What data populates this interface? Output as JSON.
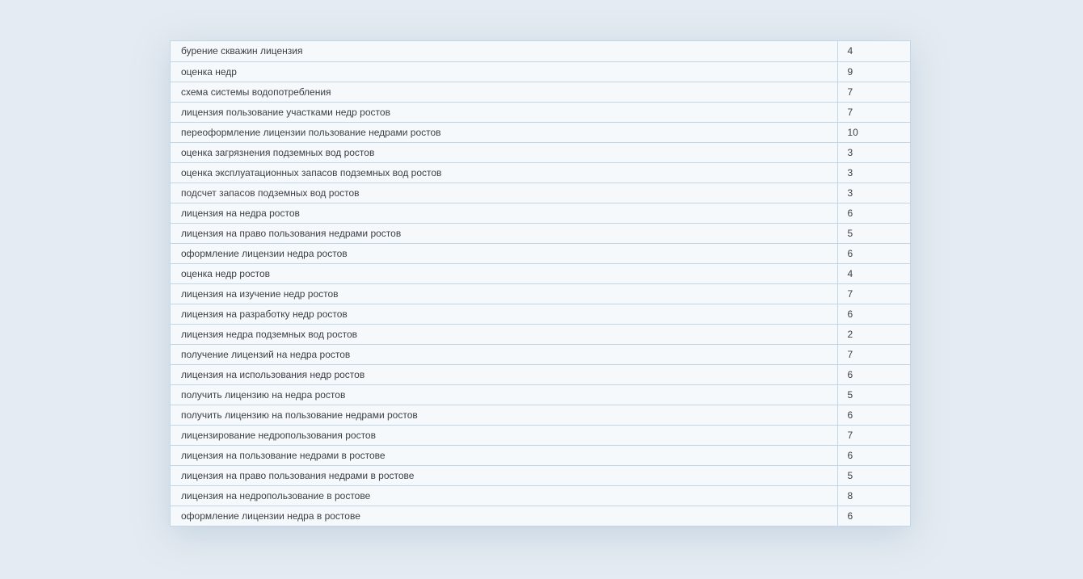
{
  "table": {
    "rows": [
      {
        "keyword": "бурение скважин лицензия",
        "count": "4"
      },
      {
        "keyword": "оценка недр",
        "count": "9"
      },
      {
        "keyword": "схема системы водопотребления",
        "count": "7"
      },
      {
        "keyword": "лицензия пользование участками недр ростов",
        "count": "7"
      },
      {
        "keyword": "переоформление лицензии пользование недрами ростов",
        "count": "10"
      },
      {
        "keyword": "оценка загрязнения подземных вод ростов",
        "count": "3"
      },
      {
        "keyword": "оценка эксплуатационных запасов подземных вод ростов",
        "count": "3"
      },
      {
        "keyword": "подсчет запасов подземных вод ростов",
        "count": "3"
      },
      {
        "keyword": "лицензия на недра ростов",
        "count": "6"
      },
      {
        "keyword": "лицензия на право пользования недрами ростов",
        "count": "5"
      },
      {
        "keyword": "оформление лицензии недра ростов",
        "count": "6"
      },
      {
        "keyword": "оценка недр ростов",
        "count": "4"
      },
      {
        "keyword": "лицензия на изучение недр ростов",
        "count": "7"
      },
      {
        "keyword": "лицензия на разработку недр ростов",
        "count": "6"
      },
      {
        "keyword": "лицензия недра подземных вод ростов",
        "count": "2"
      },
      {
        "keyword": "получение лицензий на недра ростов",
        "count": "7"
      },
      {
        "keyword": "лицензия на использования недр ростов",
        "count": "6"
      },
      {
        "keyword": "получить лицензию на недра ростов",
        "count": "5"
      },
      {
        "keyword": "получить лицензию на пользование недрами ростов",
        "count": "6"
      },
      {
        "keyword": "лицензирование недропользования ростов",
        "count": "7"
      },
      {
        "keyword": "лицензия на пользование недрами в ростове",
        "count": "6"
      },
      {
        "keyword": "лицензия на право пользования недрами в ростове",
        "count": "5"
      },
      {
        "keyword": "лицензия на недропользование в ростове",
        "count": "8"
      },
      {
        "keyword": "оформление лицензии недра в ростове",
        "count": "6"
      }
    ]
  }
}
